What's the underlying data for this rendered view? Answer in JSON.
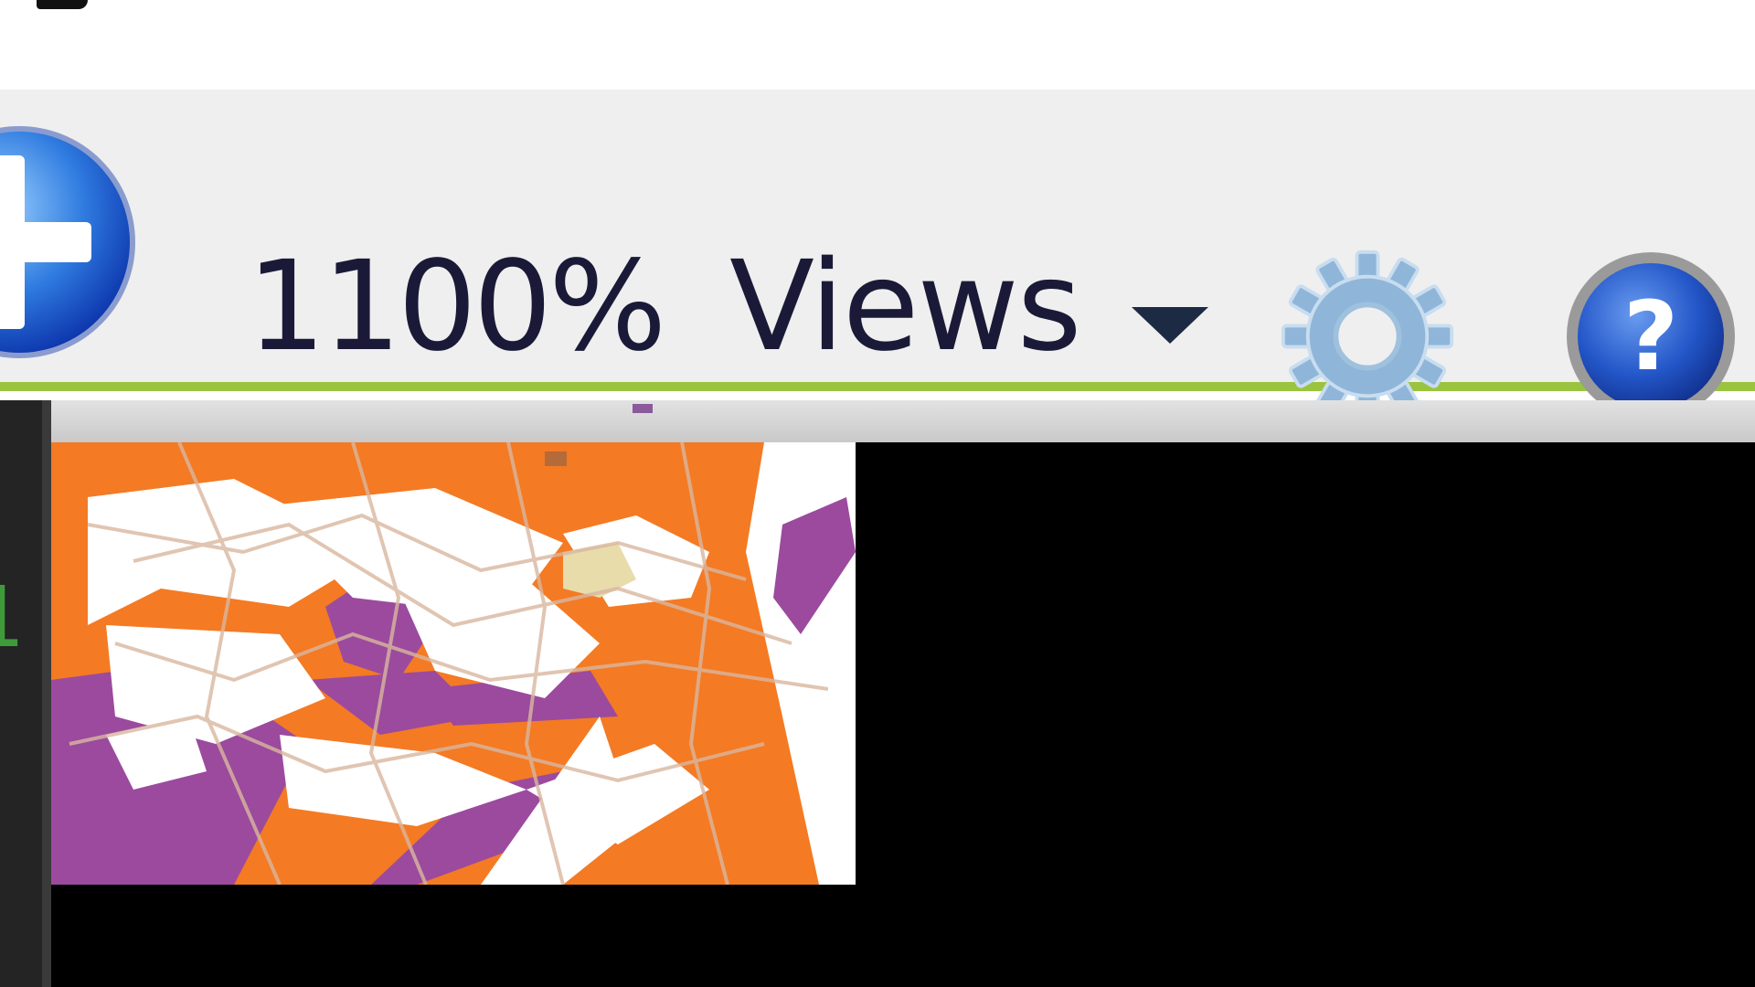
{
  "toolbar": {
    "zoom_level": "1100%",
    "views_label": "Views",
    "icons": {
      "navigation": "zoom-in-circle-icon",
      "views_dropdown": "chevron-down-icon",
      "settings": "gear-icon",
      "help": "help-question-icon"
    },
    "accent_color": "#9ac43f"
  },
  "editor": {
    "line_number": "1"
  },
  "viewer": {
    "image_colors": {
      "orange": "#f47a24",
      "purple": "#9b4a9e",
      "white": "#ffffff"
    },
    "background": "#000000"
  }
}
